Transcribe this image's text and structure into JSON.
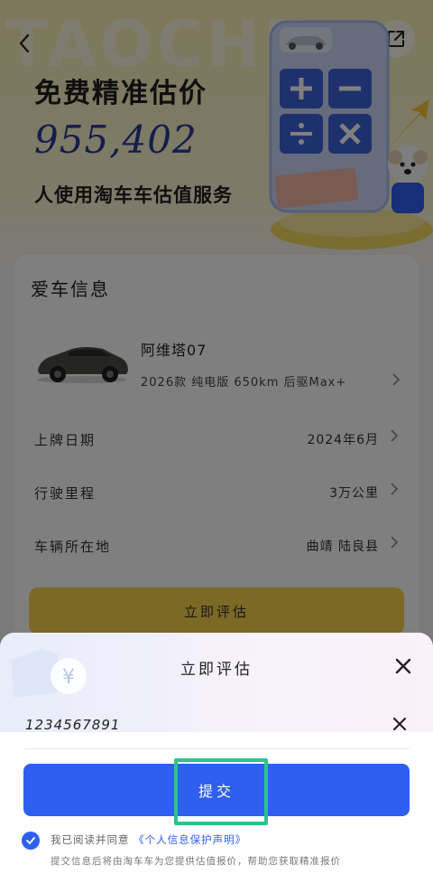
{
  "header": {
    "watermark": "TAOCHE",
    "back_icon": "chevron-left-icon",
    "share_icon": "share-external-icon"
  },
  "hero": {
    "title": "免费精准估价",
    "count": "955,402",
    "subtitle": "人使用淘车车估值服务"
  },
  "card": {
    "title": "爱车信息",
    "car_name": "阿维塔07",
    "car_spec": "2026款 纯电版 650km 后驱Max+",
    "rows": [
      {
        "label": "上牌日期",
        "value": "2024年6月"
      },
      {
        "label": "行驶里程",
        "value": "3万公里"
      },
      {
        "label": "车辆所在地",
        "value": "曲靖 陆良县"
      }
    ],
    "eval_button": "立即评估"
  },
  "sheet": {
    "title": "立即评估",
    "phone_value": "1234567891",
    "submit_label": "提交",
    "agree_prefix": "我已阅读并同意",
    "agree_link": "《个人信息保护声明》",
    "note": "提交信息后将由淘车车为您提供估值报价，帮助您获取精准报价"
  },
  "colors": {
    "accent_blue": "#2f5ff0",
    "brand_yellow": "#f7d34a",
    "highlight_green": "#2bc48a",
    "count_blue": "#2a3a9b"
  }
}
